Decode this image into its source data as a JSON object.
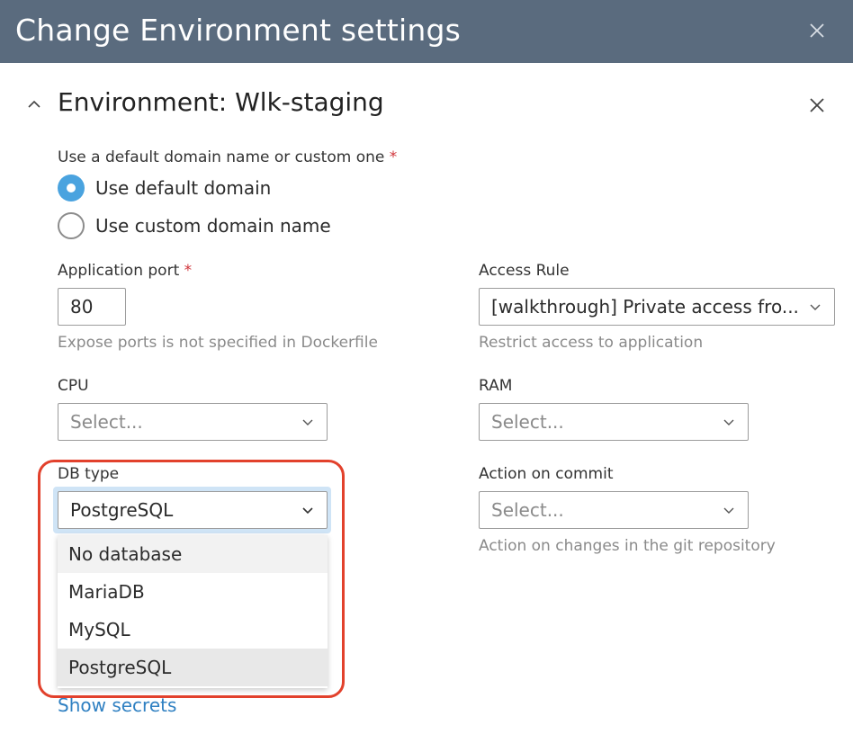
{
  "dialog": {
    "title": "Change Environment settings"
  },
  "section": {
    "title": "Environment: Wlk-staging"
  },
  "domain": {
    "label": "Use a default domain name or custom one",
    "required_mark": "*",
    "options": [
      {
        "label": "Use default domain",
        "checked": true
      },
      {
        "label": "Use custom domain name",
        "checked": false
      }
    ]
  },
  "port": {
    "label": "Application port",
    "required_mark": "*",
    "value": "80",
    "hint": "Expose ports is not specified in Dockerfile"
  },
  "access_rule": {
    "label": "Access Rule",
    "value": "[walkthrough] Private access fro...",
    "hint": "Restrict access to application"
  },
  "cpu": {
    "label": "CPU",
    "placeholder": "Select..."
  },
  "ram": {
    "label": "RAM",
    "placeholder": "Select..."
  },
  "db_type": {
    "label": "DB type",
    "value": "PostgreSQL",
    "options": [
      "No database",
      "MariaDB",
      "MySQL",
      "PostgreSQL"
    ]
  },
  "action_on_commit": {
    "label": "Action on commit",
    "placeholder": "Select...",
    "hint": "Action on changes in the git repository"
  },
  "secrets_link": "Show secrets",
  "colors": {
    "header_bg": "#5a6b7e",
    "accent": "#4aa3df",
    "link": "#2f80c2",
    "required": "#d0343a",
    "highlight": "#e2412c"
  },
  "icons": {
    "header_close": "close-icon",
    "section_collapse": "chevron-up-icon",
    "section_close": "close-icon",
    "select_arrow": "chevron-down-icon"
  }
}
